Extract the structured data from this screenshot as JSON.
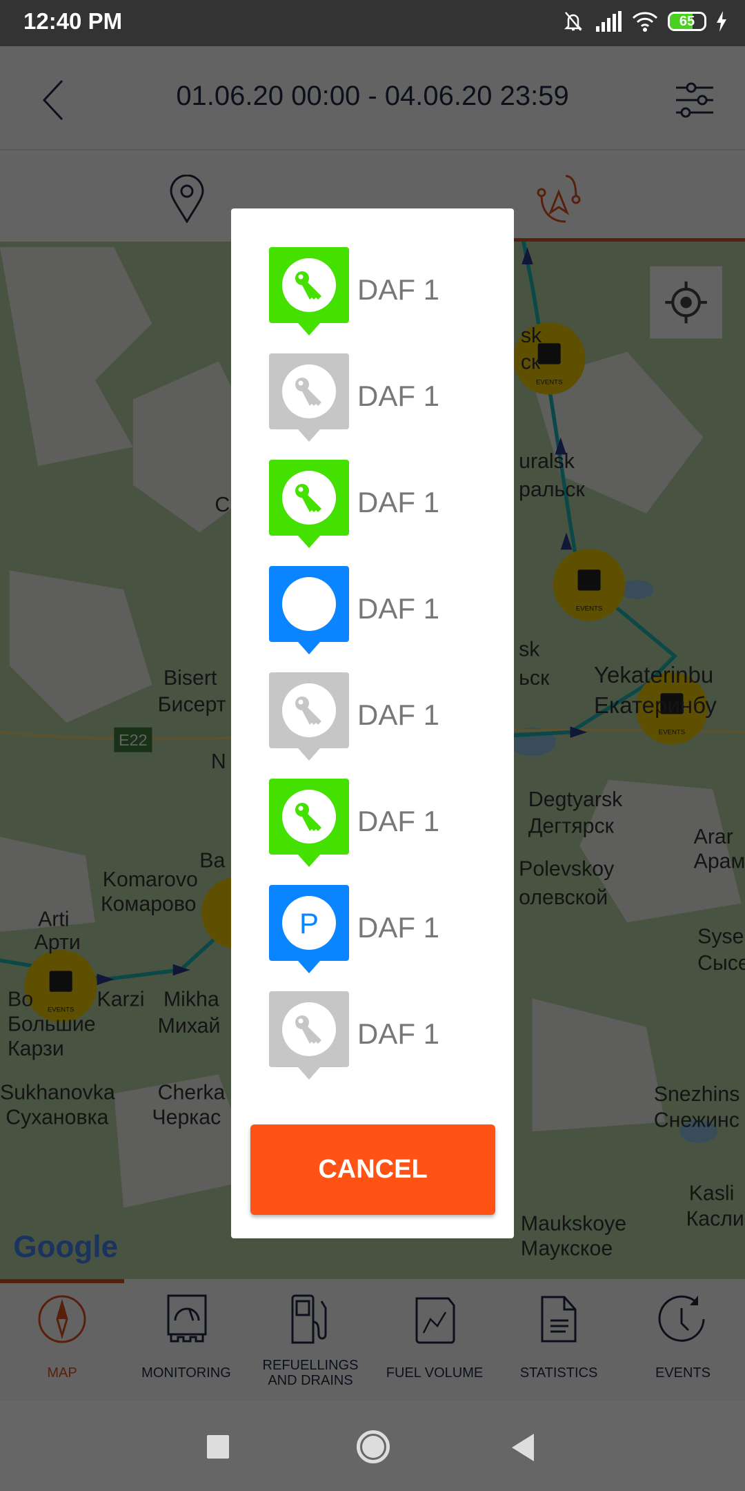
{
  "status_bar": {
    "time": "12:40 PM",
    "battery": "65",
    "battery_level_percent": 65
  },
  "header": {
    "date_range": "01.06.20 00:00 - 04.06.20 23:59",
    "back_icon": "chevron-left-icon",
    "filter_icon": "sliders-icon"
  },
  "tabs": [
    {
      "icon": "location-pin-icon",
      "active": false
    },
    {
      "icon": "route-icon",
      "active": true
    }
  ],
  "map": {
    "labels": [
      "sk",
      "ск",
      "uralsk",
      "ральск",
      "sk",
      "ьск",
      "Yekaterinbu",
      "Екатеринбу",
      "Degtyarsk",
      "Дегтярск",
      "Polevskoy",
      "олевской",
      "Arar",
      "Арам",
      "Syse",
      "Сысе",
      "Snezhins",
      "Снежинс",
      "Kasli",
      "Касли",
      "Maukskoye",
      "Маукское",
      "Bisert",
      "Бисерт",
      "N",
      "Komarovo",
      "Комарово",
      "Ba",
      "Arti",
      "Арти",
      "Bo",
      "Karzi",
      "Большие",
      "Карзи",
      "Mikha",
      "Михай",
      "Sukhanovka",
      "Сухановка",
      "Cherka",
      "Черкас",
      "C"
    ],
    "road_badge": "E22",
    "event_marker_label": "EVENTS",
    "google_logo": "Google",
    "route_color": "#1fb8b8",
    "event_color": "#f2cd00"
  },
  "dialog": {
    "items": [
      {
        "label": "DAF 1",
        "icon": "key-icon",
        "color": "#44e000"
      },
      {
        "label": "DAF 1",
        "icon": "key-icon",
        "color": "#c6c6c6"
      },
      {
        "label": "DAF 1",
        "icon": "key-icon",
        "color": "#44e000"
      },
      {
        "label": "DAF 1",
        "icon": "circle-icon",
        "color": "#0a84ff"
      },
      {
        "label": "DAF 1",
        "icon": "key-icon",
        "color": "#c6c6c6"
      },
      {
        "label": "DAF 1",
        "icon": "key-icon",
        "color": "#44e000"
      },
      {
        "label": "DAF 1",
        "icon": "parking-icon",
        "color": "#0a84ff",
        "glyph": "P"
      },
      {
        "label": "DAF 1",
        "icon": "key-icon",
        "color": "#c6c6c6"
      }
    ],
    "cancel_label": "CANCEL",
    "cancel_color": "#ff5316"
  },
  "bottom_nav": [
    {
      "label": "MAP",
      "icon": "compass-icon",
      "active": true
    },
    {
      "label": "MONITORING",
      "icon": "gauge-icon"
    },
    {
      "label": "REFUELLINGS AND DRAINS",
      "icon": "fuel-pump-icon"
    },
    {
      "label": "FUEL VOLUME",
      "icon": "chart-line-icon"
    },
    {
      "label": "STATISTICS",
      "icon": "document-icon"
    },
    {
      "label": "EVENTS",
      "icon": "clock-icon"
    }
  ],
  "accent_color": "#e0521e"
}
